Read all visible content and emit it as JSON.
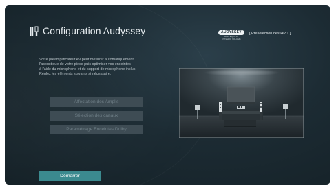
{
  "header": {
    "title": "Configuration Audyssey",
    "title_icon": "speaker-setup-icon",
    "brand": {
      "name": "AUDYSSEY",
      "line1": "MULTEQ XT32",
      "line2": "DYNAMIC VOLUME"
    },
    "preset_label": "[ Présélection des HP 1 ]"
  },
  "description": {
    "lines": [
      "Votre préamplificateur AV peut mesurer automatiquement",
      "l'acoustique de votre pièce puis optimiser vos enceintes",
      "à l'aide du microphone et du support de microphone inclus.",
      "Réglez les éléments suivants si nécessaire."
    ]
  },
  "menu": {
    "items": [
      {
        "label": "Affectation des Amplis",
        "state": "disabled"
      },
      {
        "label": "Sélection des canaux",
        "state": "disabled"
      },
      {
        "label": "Paramétrage Enceintes Dolby",
        "state": "disabled"
      }
    ]
  },
  "actions": {
    "start_label": "Démarrer"
  },
  "illustration": {
    "subject": "listening-room-speaker-layout",
    "icon": "room-illustration"
  },
  "colors": {
    "background": "#1c2b33",
    "title_text": "#e6ecef",
    "menu_button_bg": "#3e4c54",
    "menu_button_text": "#6f7f87",
    "start_button_bg": "#3b8a8f",
    "start_button_text": "#ffffff"
  }
}
